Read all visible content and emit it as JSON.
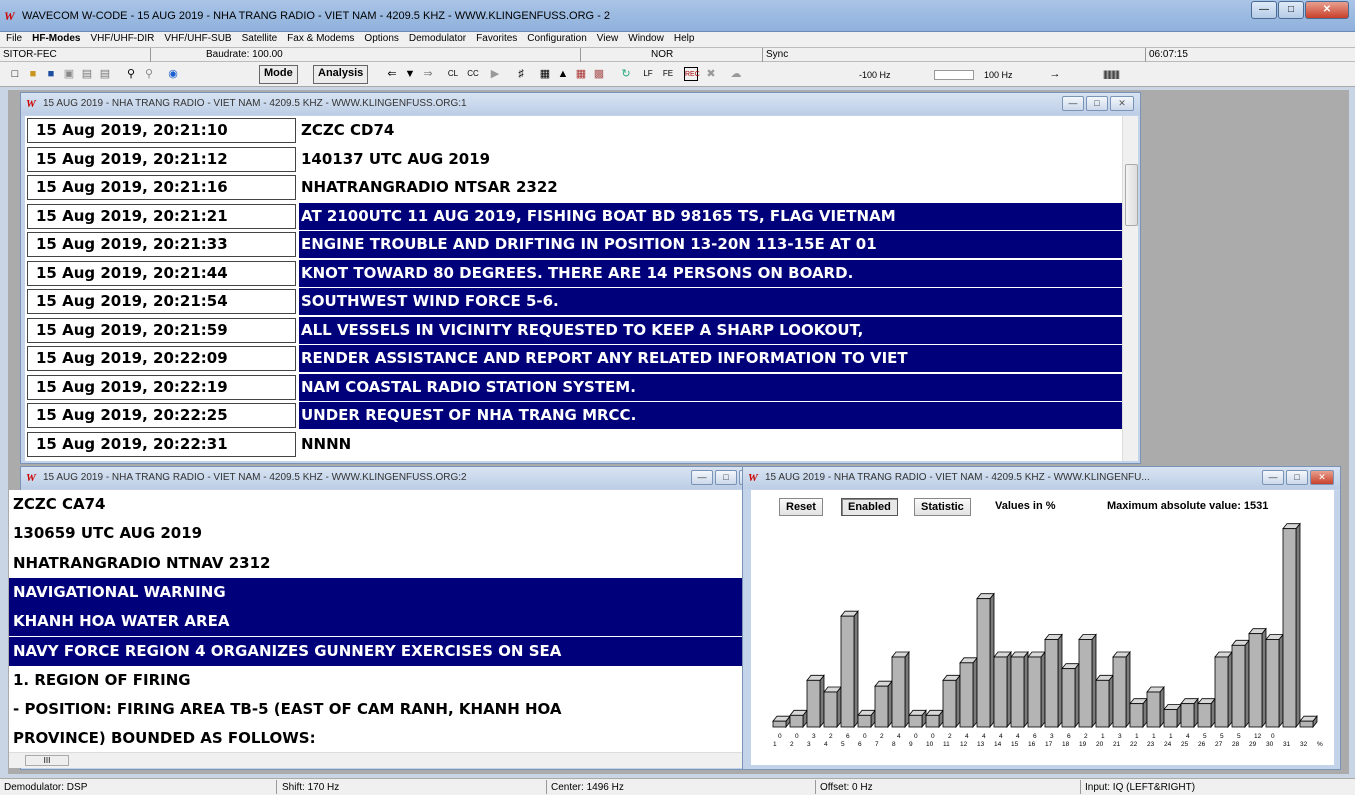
{
  "app": {
    "title": "WAVECOM W-CODE - 15 AUG 2019  -  NHA TRANG RADIO  -  VIET NAM  -  4209.5 KHZ  -  WWW.KLINGENFUSS.ORG  -  2",
    "logo": "W"
  },
  "menu": [
    "File",
    "HF-Modes",
    "VHF/UHF-DIR",
    "VHF/UHF-SUB",
    "Satellite",
    "Fax & Modems",
    "Options",
    "Demodulator",
    "Favorites",
    "Configuration",
    "View",
    "Window",
    "Help"
  ],
  "statusbar": {
    "mode": "SITOR-FEC",
    "baudrate": "Baudrate: 100.00",
    "nor": "NOR",
    "sync": "Sync",
    "time": "06:07:15"
  },
  "toolbar": {
    "mode_label": "Mode",
    "analysis_label": "Analysis",
    "freq_low": "-100 Hz",
    "freq_high": "100 Hz",
    "icons": [
      "new-icon",
      "open-icon",
      "save-icon",
      "copy-icon",
      "print-icon",
      "print2-icon",
      "find-icon",
      "find-next-icon",
      "help-icon",
      "arrow-left-icon",
      "arrow-down-icon",
      "arrow-right-icon",
      "cl-icon",
      "ccc-icon",
      "play-icon",
      "tune-icon",
      "keyboard-icon",
      "antenna-icon",
      "grid-icon",
      "matrix-icon",
      "refresh-icon",
      "lf-icon",
      "fe-icon",
      "rec-icon",
      "cross-icon",
      "cloud-icon",
      "marker-icon",
      "ruler-icon"
    ]
  },
  "window1": {
    "title": "15 AUG 2019  -  NHA TRANG RADIO  -  VIET NAM  -  4209.5 KHZ  -  WWW.KLINGENFUSS.ORG:1",
    "rows": [
      {
        "ts": "15 Aug 2019, 20:21:10",
        "msg": "ZCZC CD74",
        "hl": false
      },
      {
        "ts": "15 Aug 2019, 20:21:12",
        "msg": "140137 UTC AUG 2019",
        "hl": false
      },
      {
        "ts": "15 Aug 2019, 20:21:16",
        "msg": "NHATRANGRADIO NTSAR 2322",
        "hl": false
      },
      {
        "ts": "15 Aug 2019, 20:21:21",
        "msg": "AT 2100UTC 11 AUG 2019, FISHING BOAT BD 98165 TS, FLAG VIETNAM",
        "hl": true
      },
      {
        "ts": "15 Aug 2019, 20:21:33",
        "msg": "ENGINE TROUBLE AND DRIFTING IN POSITION 13-20N 113-15E AT 01",
        "hl": true
      },
      {
        "ts": "15 Aug 2019, 20:21:44",
        "msg": "KNOT TOWARD 80 DEGREES. THERE ARE 14 PERSONS ON BOARD.",
        "hl": true
      },
      {
        "ts": "15 Aug 2019, 20:21:54",
        "msg": "SOUTHWEST WIND FORCE 5-6.",
        "hl": true
      },
      {
        "ts": "15 Aug 2019, 20:21:59",
        "msg": "ALL VESSELS IN VICINITY REQUESTED TO KEEP A SHARP LOOKOUT,",
        "hl": true
      },
      {
        "ts": "15 Aug 2019, 20:22:09",
        "msg": "RENDER ASSISTANCE AND REPORT ANY RELATED INFORMATION TO VIET",
        "hl": true
      },
      {
        "ts": "15 Aug 2019, 20:22:19",
        "msg": "NAM COASTAL RADIO STATION SYSTEM.",
        "hl": true
      },
      {
        "ts": "15 Aug 2019, 20:22:25",
        "msg": "UNDER REQUEST OF NHA TRANG MRCC.",
        "hl": true
      },
      {
        "ts": "15 Aug 2019, 20:22:31",
        "msg": "NNNN",
        "hl": false
      }
    ]
  },
  "window2": {
    "title": "15 AUG 2019  -  NHA TRANG RADIO  -  VIET NAM  -  4209.5 KHZ  -  WWW.KLINGENFUSS.ORG:2",
    "lines": [
      {
        "text": "ZCZC CA74",
        "hl": false
      },
      {
        "text": "130659 UTC AUG 2019",
        "hl": false
      },
      {
        "text": "NHATRANGRADIO NTNAV 2312",
        "hl": false
      },
      {
        "text": "NAVIGATIONAL WARNING",
        "hl": true
      },
      {
        "text": "KHANH HOA WATER AREA",
        "hl": true
      },
      {
        "text": "NAVY FORCE REGION 4 ORGANIZES GUNNERY EXERCISES ON SEA",
        "hl": true
      },
      {
        "text": "1. REGION OF FIRING",
        "hl": false
      },
      {
        "text": "- POSITION: FIRING AREA TB-5 (EAST OF CAM RANH, KHANH HOA",
        "hl": false
      },
      {
        "text": "PROVINCE) BOUNDED AS FOLLOWS:",
        "hl": false
      }
    ]
  },
  "window3": {
    "title": "15 AUG 2019  -  NHA TRANG RADIO  -  VIET NAM  -  4209.5 KHZ  -  WWW.KLINGENFU...",
    "reset_label": "Reset",
    "enabled_label": "Enabled",
    "statistic_label": "Statistic",
    "values_label": "Values in %",
    "max_label": "Maximum absolute value: 1531"
  },
  "chart_data": {
    "type": "bar",
    "categories": [
      "1",
      "2",
      "3",
      "4",
      "5",
      "6",
      "7",
      "8",
      "9",
      "10",
      "11",
      "12",
      "13",
      "14",
      "15",
      "16",
      "17",
      "18",
      "19",
      "20",
      "21",
      "22",
      "23",
      "24",
      "25",
      "26",
      "27",
      "28",
      "29",
      "30",
      "31",
      "32",
      "%"
    ],
    "value_labels": [
      "0",
      "0",
      "3",
      "2",
      "6",
      "0",
      "2",
      "4",
      "0",
      "0",
      "2",
      "4",
      "4",
      "4",
      "4",
      "6",
      "3",
      "6",
      "2",
      "1",
      "3",
      "1",
      "1",
      "1",
      "4",
      "5",
      "5",
      "5",
      "12",
      "0",
      ""
    ],
    "values": [
      1,
      2,
      8,
      6,
      19,
      2,
      7,
      12,
      2,
      2,
      8,
      11,
      22,
      12,
      12,
      12,
      15,
      10,
      15,
      8,
      12,
      4,
      6,
      3,
      4,
      4,
      12,
      14,
      16,
      15,
      34,
      1
    ],
    "ylim": [
      0,
      36
    ]
  },
  "bottom": {
    "demodulator": "Demodulator: DSP",
    "shift": "Shift: 170 Hz",
    "center": "Center: 1496 Hz",
    "offset": "Offset: 0 Hz",
    "input": "Input: IQ (LEFT&RIGHT)"
  }
}
